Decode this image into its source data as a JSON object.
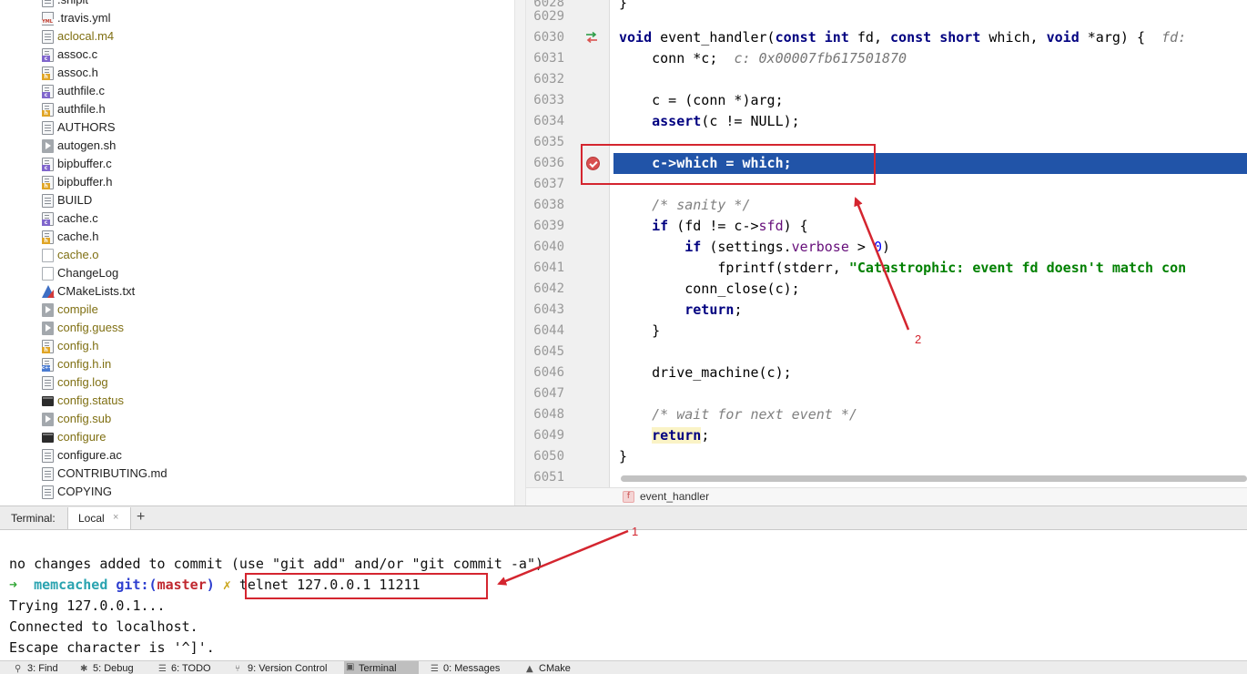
{
  "tree": {
    "items": [
      {
        "name": ".shipit",
        "icon": "text-file-icon",
        "ignored": false
      },
      {
        "name": ".travis.yml",
        "icon": "yaml-file-icon",
        "ignored": false
      },
      {
        "name": "aclocal.m4",
        "icon": "text-file-icon",
        "ignored": true
      },
      {
        "name": "assoc.c",
        "icon": "c-file-icon",
        "ignored": false
      },
      {
        "name": "assoc.h",
        "icon": "h-file-icon",
        "ignored": false
      },
      {
        "name": "authfile.c",
        "icon": "c-file-icon",
        "ignored": false
      },
      {
        "name": "authfile.h",
        "icon": "h-file-icon",
        "ignored": false
      },
      {
        "name": "AUTHORS",
        "icon": "text-file-icon",
        "ignored": false
      },
      {
        "name": "autogen.sh",
        "icon": "shell-script-icon",
        "ignored": false
      },
      {
        "name": "bipbuffer.c",
        "icon": "c-file-icon",
        "ignored": false
      },
      {
        "name": "bipbuffer.h",
        "icon": "h-file-icon",
        "ignored": false
      },
      {
        "name": "BUILD",
        "icon": "text-file-icon",
        "ignored": false
      },
      {
        "name": "cache.c",
        "icon": "c-file-icon",
        "ignored": false
      },
      {
        "name": "cache.h",
        "icon": "h-file-icon",
        "ignored": false
      },
      {
        "name": "cache.o",
        "icon": "blank-file-icon",
        "ignored": true
      },
      {
        "name": "ChangeLog",
        "icon": "blank-file-icon",
        "ignored": false
      },
      {
        "name": "CMakeLists.txt",
        "icon": "cmake-file-icon",
        "ignored": false
      },
      {
        "name": "compile",
        "icon": "shell-script-icon",
        "ignored": true
      },
      {
        "name": "config.guess",
        "icon": "shell-script-icon",
        "ignored": true
      },
      {
        "name": "config.h",
        "icon": "h-file-icon",
        "ignored": true
      },
      {
        "name": "config.h.in",
        "icon": "cpp-file-icon",
        "ignored": true
      },
      {
        "name": "config.log",
        "icon": "text-file-icon",
        "ignored": true
      },
      {
        "name": "config.status",
        "icon": "executable-file-icon",
        "ignored": true
      },
      {
        "name": "config.sub",
        "icon": "shell-script-icon",
        "ignored": true
      },
      {
        "name": "configure",
        "icon": "executable-file-icon",
        "ignored": true
      },
      {
        "name": "configure.ac",
        "icon": "text-file-icon",
        "ignored": false
      },
      {
        "name": "CONTRIBUTING.md",
        "icon": "text-file-icon",
        "ignored": false
      },
      {
        "name": "COPYING",
        "icon": "text-file-icon",
        "ignored": false
      }
    ]
  },
  "editor": {
    "lines": [
      {
        "n": "6028",
        "code": "}"
      },
      {
        "n": "6029",
        "code": ""
      },
      {
        "n": "6030",
        "code": "void event_handler(const int fd, const short which, void *arg) {  fd: "
      },
      {
        "n": "6031",
        "code": "    conn *c;  c: 0x00007fb617501870"
      },
      {
        "n": "6032",
        "code": ""
      },
      {
        "n": "6033",
        "code": "    c = (conn *)arg;"
      },
      {
        "n": "6034",
        "code": "    assert(c != NULL);"
      },
      {
        "n": "6035",
        "code": ""
      },
      {
        "n": "6036",
        "code": "    c->which = which;"
      },
      {
        "n": "6037",
        "code": ""
      },
      {
        "n": "6038",
        "code": "    /* sanity */"
      },
      {
        "n": "6039",
        "code": "    if (fd != c->sfd) {"
      },
      {
        "n": "6040",
        "code": "        if (settings.verbose > 0)"
      },
      {
        "n": "6041",
        "code": "            fprintf(stderr, \"Catastrophic: event fd doesn't match con"
      },
      {
        "n": "6042",
        "code": "        conn_close(c);"
      },
      {
        "n": "6043",
        "code": "        return;"
      },
      {
        "n": "6044",
        "code": "    }"
      },
      {
        "n": "6045",
        "code": ""
      },
      {
        "n": "6046",
        "code": "    drive_machine(c);"
      },
      {
        "n": "6047",
        "code": ""
      },
      {
        "n": "6048",
        "code": "    /* wait for next event */"
      },
      {
        "n": "6049",
        "code": "    return;"
      },
      {
        "n": "6050",
        "code": "}"
      },
      {
        "n": "6051",
        "code": ""
      }
    ],
    "tok": {
      "void": "void",
      "event_handler": " event_handler(",
      "const": "const",
      "int": "int",
      "fd_param": " fd, ",
      "short": "short",
      "which_param": " which, ",
      "arg_param": " *arg) {  ",
      "fd_hint": "fd: ",
      "conn_decl": "    conn *c;  ",
      "c_hint": "c: 0x00007fb617501870",
      "c_assign": "    c = (conn *)arg;",
      "assert_pre": "    ",
      "assert_kw": "assert",
      "assert_post": "(c != NULL);",
      "which_assign": "    c->which = which;",
      "sanity_indent": "    ",
      "sanity": "/* sanity */",
      "if_indent": "    ",
      "if_kw": "if",
      "if_pre": " (fd != c->",
      "sfd": "sfd",
      "if_post": ") {",
      "if2_indent": "        ",
      "if2_kw": "if",
      "if2_pre": " (settings.",
      "verbose": "verbose",
      "if2_mid": " > ",
      "zero": "0",
      "if2_post": ")",
      "fprintf_pre": "            fprintf(stderr, ",
      "fprintf_str": "\"Catastrophic: event fd doesn't match con",
      "close": "        conn_close(c);",
      "ret1_indent": "        ",
      "ret1": "return",
      "semi": ";",
      "brace_close_inner": "    }",
      "drive": "    drive_machine(c);",
      "wait_indent": "    ",
      "wait": "/* wait for next event */",
      "ret2_indent": "    ",
      "ret2": "return",
      "brace_close": "}",
      "brace_top": "}"
    },
    "breadcrumb_fn": "event_handler",
    "fn_icon_letter": "f"
  },
  "terminal": {
    "label": "Terminal:",
    "tab": "Local",
    "tab_close": "×",
    "add": "+",
    "line1": "no changes added to commit (use \"git add\" and/or \"git commit -a\")",
    "prompt_arrow": "➜",
    "prompt_dir": "memcached",
    "prompt_git": "git:(",
    "prompt_branch": "master",
    "prompt_git_close": ")",
    "prompt_x": "✗",
    "command": "telnet 127.0.0.1 11211",
    "line3": "Trying 127.0.0.1...",
    "line4": "Connected to localhost.",
    "line5": "Escape character is '^]'."
  },
  "toolbar": {
    "items": [
      {
        "label": "3: Find",
        "icon": "search-icon",
        "glyph": "⚲"
      },
      {
        "label": "5: Debug",
        "icon": "debug-icon",
        "glyph": "✱"
      },
      {
        "label": "6: TODO",
        "icon": "todo-icon",
        "glyph": "☰"
      },
      {
        "label": "9: Version Control",
        "icon": "version-control-icon",
        "glyph": "⑂"
      },
      {
        "label": "Terminal",
        "icon": "terminal-icon",
        "glyph": "▣"
      },
      {
        "label": "0: Messages",
        "icon": "messages-icon",
        "glyph": "☰"
      },
      {
        "label": "CMake",
        "icon": "cmake-icon",
        "glyph": "▲"
      }
    ]
  },
  "annotations": {
    "one": "1",
    "two": "2"
  },
  "colors": {
    "accent": "#2154a8",
    "annotation": "#d4252f"
  }
}
